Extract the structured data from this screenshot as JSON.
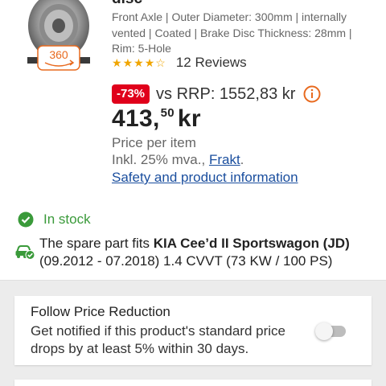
{
  "product": {
    "title_fragment": "disc",
    "specs": "Front Axle | Outer Diameter: 300mm | internally vented | Coated | Brake Disc Thickness: 28mm | Rim: 5-Hole",
    "badge_360": "360",
    "rating": {
      "stars": 4,
      "max": 5,
      "reviews": "12 Reviews"
    },
    "discount": "-73%",
    "rrp": "vs RRP: 1552,83 kr",
    "price_main": "413,",
    "price_decimals": "50",
    "price_currency": "kr",
    "price_per": "Price per item",
    "vat_text": "Inkl. 25% mva., ",
    "vat_link": "Frakt",
    "vat_suffix": ".",
    "safety_link": "Safety and product information"
  },
  "stock": {
    "label": "In stock",
    "color": "#3a9a3a"
  },
  "fitment": {
    "prefix": "The spare part fits ",
    "vehicle": "KIA Cee’d II Sportswagon (JD)",
    "details": " (09.2012 - 07.2018) 1.4 CVVT (73 KW / 100 PS)"
  },
  "follow_price": {
    "title": "Follow Price Reduction",
    "description": "Get notified if this product's standard price drops by at least 5% within 30 days.",
    "toggle_on": false
  },
  "colors": {
    "discount": "#e0001b",
    "link": "#1a4e9e",
    "star": "#f0a500",
    "badge": "#e86a1f"
  }
}
